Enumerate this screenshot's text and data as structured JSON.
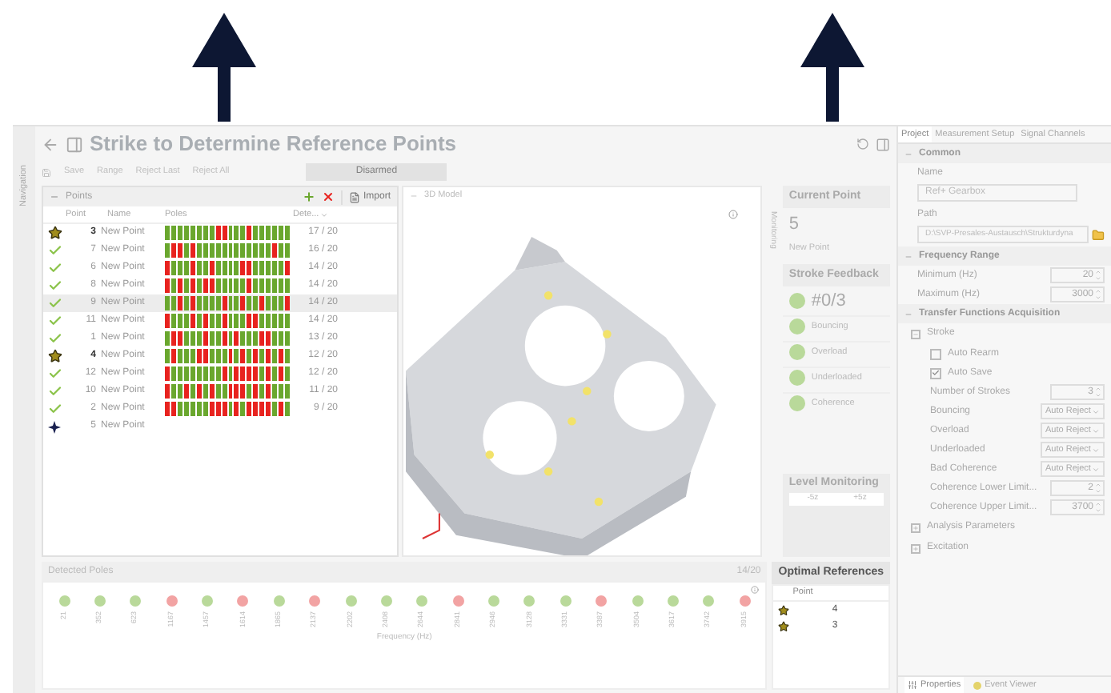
{
  "sidebar": {
    "label": "Navigation"
  },
  "header": {
    "title": "Strike to Determine Reference Points"
  },
  "toolbar": {
    "items": [
      "Save",
      "Range",
      "Reject Last",
      "Reject All"
    ],
    "state_button": "Disarmed"
  },
  "points_panel": {
    "title": "Points",
    "import_label": "Import",
    "columns": [
      "Point",
      "Name",
      "Poles",
      "Dete..."
    ],
    "rows": [
      {
        "kind": "star",
        "point": "3",
        "name": "New Point",
        "selected": false,
        "detected": "17 / 20",
        "poles": [
          true,
          true,
          true,
          true,
          true,
          true,
          true,
          true,
          false,
          false,
          true,
          true,
          true,
          false,
          true,
          true,
          true,
          true,
          true,
          true
        ]
      },
      {
        "kind": "check",
        "point": "7",
        "name": "New Point",
        "selected": false,
        "detected": "16 / 20",
        "poles": [
          true,
          false,
          false,
          true,
          false,
          true,
          true,
          true,
          true,
          true,
          true,
          true,
          true,
          true,
          true,
          true,
          true,
          false,
          true,
          true
        ]
      },
      {
        "kind": "check",
        "point": "6",
        "name": "New Point",
        "selected": false,
        "detected": "14 / 20",
        "poles": [
          false,
          true,
          true,
          true,
          false,
          true,
          true,
          false,
          true,
          true,
          true,
          true,
          false,
          false,
          true,
          true,
          true,
          true,
          true,
          false
        ]
      },
      {
        "kind": "check",
        "point": "8",
        "name": "New Point",
        "selected": false,
        "detected": "14 / 20",
        "poles": [
          false,
          true,
          false,
          true,
          false,
          true,
          false,
          false,
          true,
          true,
          true,
          true,
          true,
          false,
          true,
          true,
          true,
          true,
          true,
          true
        ]
      },
      {
        "kind": "check",
        "point": "9",
        "name": "New Point",
        "selected": true,
        "detected": "14 / 20",
        "poles": [
          true,
          true,
          false,
          true,
          false,
          true,
          true,
          true,
          true,
          false,
          true,
          true,
          false,
          true,
          true,
          false,
          true,
          true,
          true,
          false
        ]
      },
      {
        "kind": "check",
        "point": "11",
        "name": "New Point",
        "selected": false,
        "detected": "14 / 20",
        "poles": [
          false,
          true,
          true,
          true,
          false,
          true,
          false,
          true,
          true,
          false,
          true,
          true,
          true,
          false,
          false,
          true,
          true,
          true,
          true,
          true
        ]
      },
      {
        "kind": "check",
        "point": "1",
        "name": "New Point",
        "selected": false,
        "detected": "13 / 20",
        "poles": [
          true,
          false,
          false,
          true,
          true,
          true,
          false,
          true,
          true,
          false,
          true,
          false,
          true,
          true,
          true,
          false,
          false,
          true,
          true,
          true
        ]
      },
      {
        "kind": "star",
        "point": "4",
        "name": "New Point",
        "selected": false,
        "detected": "12 / 20",
        "poles": [
          true,
          false,
          true,
          true,
          true,
          false,
          false,
          true,
          true,
          true,
          false,
          true,
          false,
          true,
          false,
          true,
          false,
          true,
          false,
          true
        ]
      },
      {
        "kind": "check",
        "point": "12",
        "name": "New Point",
        "selected": false,
        "detected": "12 / 20",
        "poles": [
          false,
          true,
          true,
          true,
          true,
          true,
          true,
          true,
          true,
          false,
          true,
          false,
          false,
          false,
          false,
          true,
          false,
          true,
          false,
          true
        ]
      },
      {
        "kind": "check",
        "point": "10",
        "name": "New Point",
        "selected": false,
        "detected": "11 / 20",
        "poles": [
          false,
          true,
          true,
          false,
          true,
          false,
          true,
          false,
          true,
          true,
          false,
          false,
          false,
          true,
          false,
          true,
          false,
          true,
          true,
          true
        ]
      },
      {
        "kind": "check",
        "point": "2",
        "name": "New Point",
        "selected": false,
        "detected": "9 / 20",
        "poles": [
          false,
          false,
          true,
          true,
          true,
          true,
          true,
          false,
          false,
          false,
          true,
          false,
          true,
          false,
          false,
          false,
          false,
          true,
          false,
          true
        ]
      },
      {
        "kind": "current",
        "point": "5",
        "name": "New Point",
        "selected": false
      }
    ]
  },
  "model": {
    "title": "3D Model",
    "side_label": "Monitoring"
  },
  "current_point": {
    "title": "Current Point",
    "number": "5",
    "name": "New Point"
  },
  "stroke_feedback": {
    "title": "Stroke Feedback",
    "count": "#0/3",
    "items": [
      "Bouncing",
      "Overload",
      "Underloaded",
      "Coherence"
    ]
  },
  "level_monitoring": {
    "title": "Level Monitoring",
    "scale": [
      "-5z",
      "+5z"
    ]
  },
  "detected_poles": {
    "title": "Detected Poles",
    "count": "14/20",
    "xlabel": "Frequency (Hz)",
    "poles": [
      {
        "frequency": "21",
        "color": "#b9d99a"
      },
      {
        "frequency": "352",
        "color": "#b9d99a"
      },
      {
        "frequency": "623",
        "color": "#b9d99a"
      },
      {
        "frequency": "1167",
        "color": "#f2a3a3"
      },
      {
        "frequency": "1457",
        "color": "#b9d99a"
      },
      {
        "frequency": "1614",
        "color": "#f2a3a3"
      },
      {
        "frequency": "1865",
        "color": "#b9d99a"
      },
      {
        "frequency": "2137",
        "color": "#f2a3a3"
      },
      {
        "frequency": "2202",
        "color": "#b9d99a"
      },
      {
        "frequency": "2408",
        "color": "#b9d99a"
      },
      {
        "frequency": "2644",
        "color": "#b9d99a"
      },
      {
        "frequency": "2841",
        "color": "#f2a3a3"
      },
      {
        "frequency": "2946",
        "color": "#b9d99a"
      },
      {
        "frequency": "3128",
        "color": "#b9d99a"
      },
      {
        "frequency": "3331",
        "color": "#b9d99a"
      },
      {
        "frequency": "3387",
        "color": "#f2a3a3"
      },
      {
        "frequency": "3504",
        "color": "#b9d99a"
      },
      {
        "frequency": "3617",
        "color": "#b9d99a"
      },
      {
        "frequency": "3742",
        "color": "#b9d99a"
      },
      {
        "frequency": "3915",
        "color": "#f2a3a3"
      }
    ]
  },
  "optimal_references": {
    "title": "Optimal References",
    "columns": [
      "Point"
    ],
    "rows": [
      {
        "point": "4"
      },
      {
        "point": "3"
      }
    ]
  },
  "properties": {
    "tabs": [
      {
        "label": "Project",
        "selected": true
      },
      {
        "label": "Measurement Setup",
        "selected": false
      },
      {
        "label": "Signal Channels",
        "selected": false
      }
    ],
    "sections": [
      {
        "title": "Common",
        "expanded": true,
        "fields": [
          {
            "kind": "text",
            "label": "Name",
            "value": "Ref+ Gearbox"
          },
          {
            "kind": "path",
            "label": "Path",
            "value": "D:\\SVP-Presales-Austausch\\Strukturdyna"
          }
        ]
      },
      {
        "title": "Frequency Range",
        "expanded": true,
        "fields": [
          {
            "kind": "spin",
            "label": "Minimum (Hz)",
            "value": "20"
          },
          {
            "kind": "spin",
            "label": "Maximum (Hz)",
            "value": "3000"
          }
        ]
      },
      {
        "title": "Transfer Functions Acquisition",
        "expanded": true,
        "groups": [
          {
            "title": "Stroke",
            "expanded": true,
            "fields": [
              {
                "kind": "check",
                "label": "Auto Rearm",
                "checked": false
              },
              {
                "kind": "check",
                "label": "Auto Save",
                "checked": true
              },
              {
                "kind": "spin",
                "label": "Number of Strokes",
                "value": "3"
              },
              {
                "kind": "select",
                "label": "Bouncing",
                "value": "Auto Reject"
              },
              {
                "kind": "select",
                "label": "Overload",
                "value": "Auto Reject"
              },
              {
                "kind": "select",
                "label": "Underloaded",
                "value": "Auto Reject"
              },
              {
                "kind": "select",
                "label": "Bad Coherence",
                "value": "Auto Reject"
              },
              {
                "kind": "spin",
                "label": "Coherence Lower Limit...",
                "value": "2"
              },
              {
                "kind": "spin",
                "label": "Coherence Upper Limit...",
                "value": "3700"
              }
            ]
          },
          {
            "title": "Analysis Parameters",
            "expanded": false
          },
          {
            "title": "Excitation",
            "expanded": false
          }
        ]
      }
    ],
    "bottom_tabs": [
      {
        "label": "Properties",
        "selected": true
      },
      {
        "label": "Event Viewer",
        "selected": false
      }
    ]
  }
}
